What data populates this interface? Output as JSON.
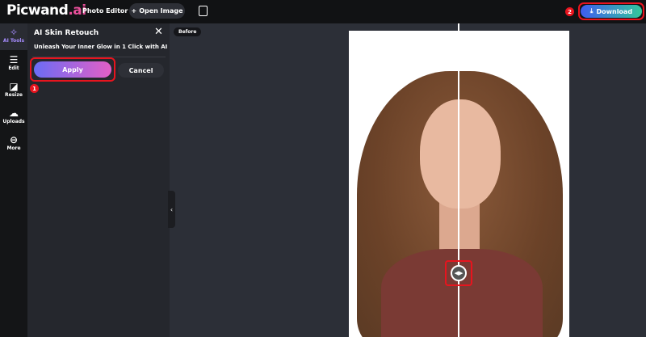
{
  "header": {
    "logo_main": "Picwand",
    "logo_suffix": ".ai",
    "photo_editor": "Photo Editor",
    "open_image": "Open Image",
    "download": "Download",
    "download_badge": "2"
  },
  "rail": [
    {
      "label": "AI Tools",
      "icon": "ai-sparkle"
    },
    {
      "label": "Edit",
      "icon": "sliders"
    },
    {
      "label": "Resize",
      "icon": "crop"
    },
    {
      "label": "Uploads",
      "icon": "cloud-upload"
    },
    {
      "label": "More",
      "icon": "ellipsis-circle"
    }
  ],
  "panel": {
    "title": "AI Skin Retouch",
    "subtitle": "Unleash Your Inner Glow in 1 Click with AI",
    "apply": "Apply",
    "cancel": "Cancel",
    "apply_badge": "1"
  },
  "canvas": {
    "before_label": "Before"
  },
  "colors": {
    "accent_red": "#e8141e",
    "apply_gradient": [
      "#6b6cf5",
      "#e35fc6"
    ],
    "download_gradient": [
      "#3f5cf0",
      "#32c79a"
    ]
  }
}
